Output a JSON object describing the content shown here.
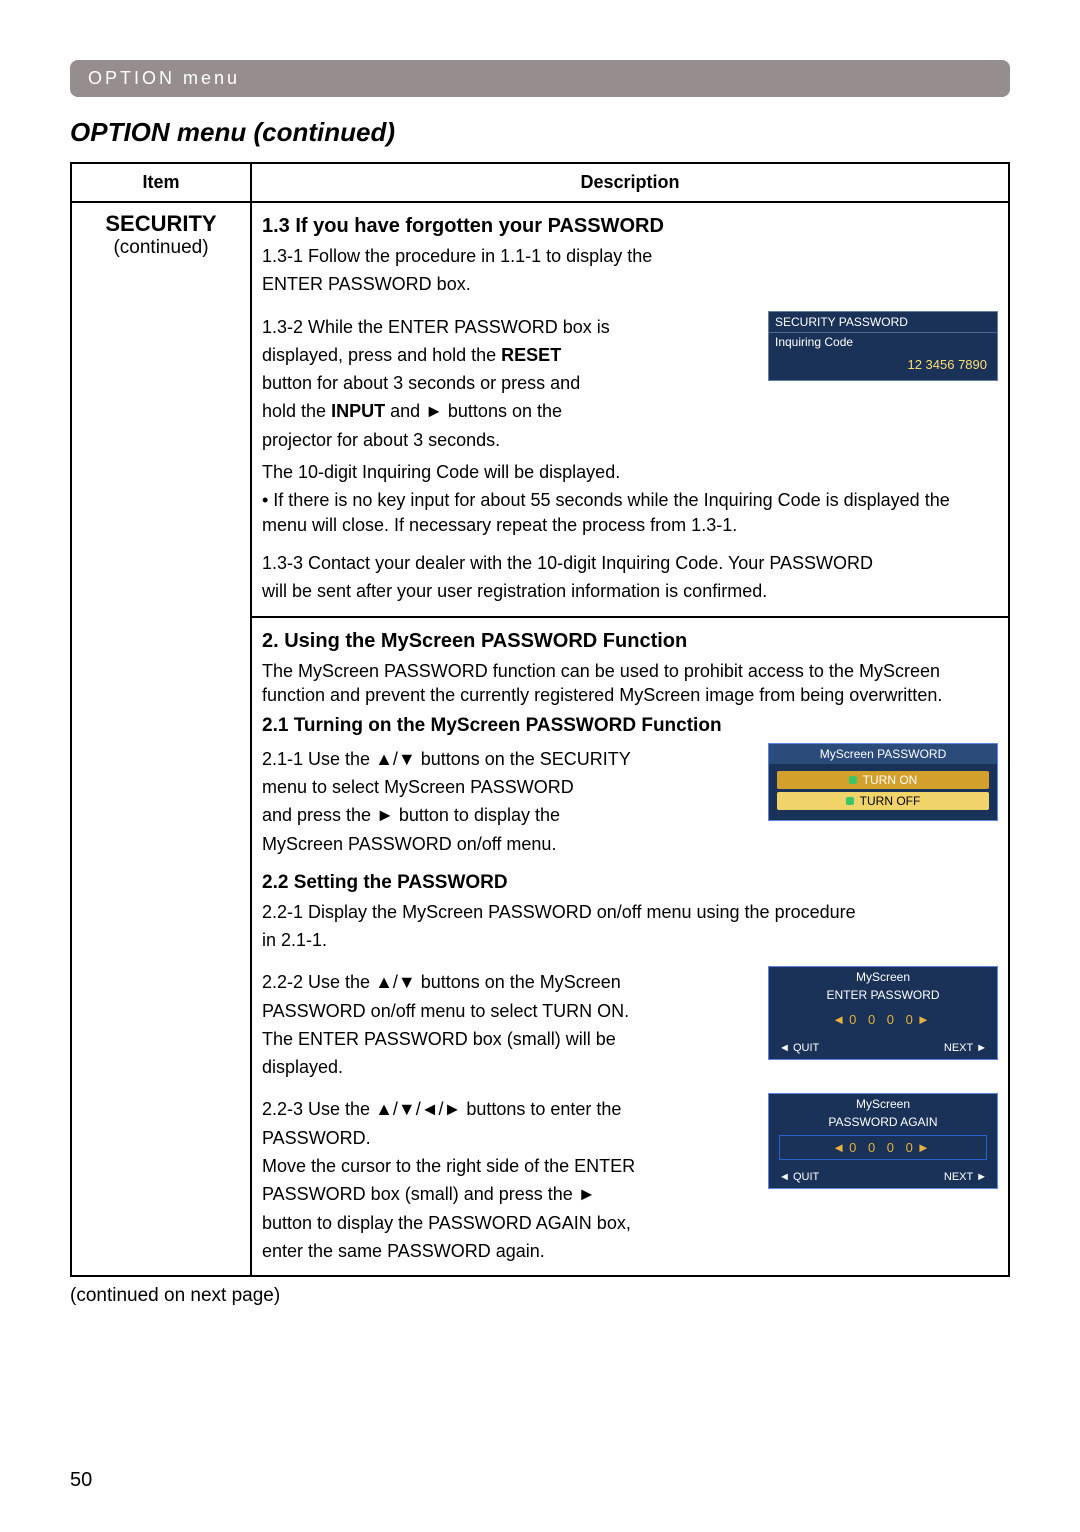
{
  "sectionBar": "OPTION menu",
  "sectionHeading": "OPTION menu (continued)",
  "pageNumber": "50",
  "contNote": "(continued on next page)",
  "table": {
    "headers": {
      "item": "Item",
      "desc": "Description"
    },
    "rowHeader": {
      "title": "SECURITY",
      "sub": "(continued)"
    },
    "s13": {
      "title": "1.3 If you have forgotten your PASSWORD",
      "p1": "1.3-1 Follow the procedure in 1.1-1 to display the",
      "p1b": "ENTER PASSWORD box.",
      "p2a": "1.3-2 While the ENTER PASSWORD box is",
      "p2b": "displayed, press and hold the ",
      "p2c": "RESET",
      "p2d": "button for about 3 seconds or press and",
      "p2e": "hold the ",
      "p2f": "INPUT",
      "p2g": " and ► buttons on the",
      "p2h": "projector for about 3 seconds.",
      "p2i": "The 10-digit Inquiring Code will be displayed.",
      "p2j": "• If there is no key input for about 55 seconds while the Inquiring Code is displayed the menu will close. If necessary repeat the process from 1.3-1.",
      "p3": "1.3-3 Contact your dealer with the 10-digit Inquiring Code. Your PASSWORD",
      "p3b": "will be sent after your user registration information is confirmed."
    },
    "osd1": {
      "title": "SECURITY PASSWORD",
      "sub": "Inquiring Code",
      "code": "12 3456 7890"
    },
    "s2": {
      "title": "2. Using the MyScreen PASSWORD Function",
      "intro": "The MyScreen PASSWORD function can be used to prohibit access to the MyScreen function and prevent the currently registered MyScreen image from being overwritten."
    },
    "s21": {
      "title": "2.1 Turning on the MyScreen PASSWORD Function",
      "p1a": "2.1-1 Use the ▲/▼ buttons on the SECURITY",
      "p1b": "menu to select MyScreen PASSWORD",
      "p1c": "and press the ► button to display the",
      "p1d": "MyScreen PASSWORD on/off menu."
    },
    "osd2": {
      "title": "MyScreen PASSWORD",
      "on": "TURN ON",
      "off": "TURN OFF"
    },
    "s22": {
      "title": "2.2 Setting the PASSWORD",
      "p1": "2.2-1 Display the MyScreen PASSWORD on/off menu using the procedure",
      "p1b": "in 2.1-1.",
      "p2a": "2.2-2 Use the ▲/▼ buttons on the MyScreen",
      "p2b": "PASSWORD on/off menu to select TURN ON.",
      "p2c": "The ENTER PASSWORD box (small) will be",
      "p2d": "displayed.",
      "p3a": "2.2-3 Use the ▲/▼/◄/► buttons to enter the",
      "p3b": "PASSWORD.",
      "p3c": "Move the cursor to the right side of the ENTER",
      "p3d": "PASSWORD box (small) and press the ►",
      "p3e": "button to display the PASSWORD AGAIN box,",
      "p3f": "enter the same PASSWORD again."
    },
    "osd3a": {
      "title": "MyScreen",
      "subtitle": "ENTER PASSWORD",
      "digits": "◄0 0 0 0►",
      "quit": "◄ QUIT",
      "next": "NEXT ►"
    },
    "osd3b": {
      "title": "MyScreen",
      "subtitle": "PASSWORD AGAIN",
      "digits": "◄0 0 0 0►",
      "quit": "◄ QUIT",
      "next": "NEXT ►"
    }
  }
}
